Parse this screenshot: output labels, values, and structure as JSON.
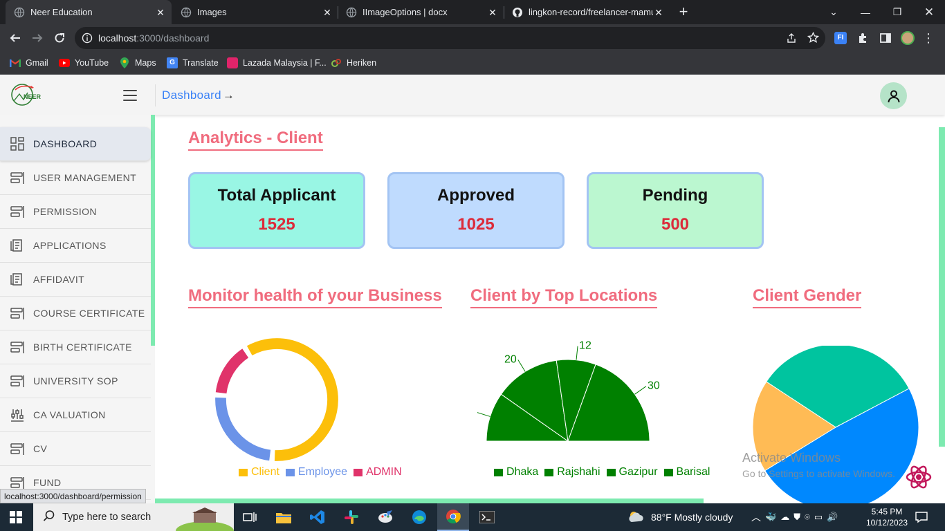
{
  "browser": {
    "tabs": [
      {
        "title": "Neer Education",
        "active": true
      },
      {
        "title": "Images",
        "active": false
      },
      {
        "title": "IImageOptions | docx",
        "active": false
      },
      {
        "title": "lingkon-record/freelancer-mamu",
        "active": false
      }
    ],
    "url_host": "localhost",
    "url_path": ":3000/dashboard",
    "bookmarks": [
      {
        "label": "Gmail",
        "icon": "gmail-icon"
      },
      {
        "label": "YouTube",
        "icon": "youtube-icon"
      },
      {
        "label": "Maps",
        "icon": "maps-icon"
      },
      {
        "label": "Translate",
        "icon": "translate-icon"
      },
      {
        "label": "Lazada Malaysia | F...",
        "icon": "lazada-icon"
      },
      {
        "label": "Heriken",
        "icon": "heriken-icon"
      }
    ],
    "status_url": "localhost:3000/dashboard/permission"
  },
  "header": {
    "logo_text": "NEER",
    "breadcrumb": "Dashboard",
    "breadcrumb_arrow": "→"
  },
  "sidebar": {
    "items": [
      {
        "label": "DASHBOARD",
        "icon": "dashboard-grid-icon",
        "active": true
      },
      {
        "label": "USER MANAGEMENT",
        "icon": "list-icon"
      },
      {
        "label": "PERMISSION",
        "icon": "list-icon"
      },
      {
        "label": "APPLICATIONS",
        "icon": "document-icon"
      },
      {
        "label": "AFFIDAVIT",
        "icon": "document-icon"
      },
      {
        "label": "COURSE CERTIFICATE",
        "icon": "list-icon"
      },
      {
        "label": "BIRTH CERTIFICATE",
        "icon": "list-icon"
      },
      {
        "label": "UNIVERSITY SOP",
        "icon": "list-icon"
      },
      {
        "label": "CA VALUATION",
        "icon": "sliders-icon"
      },
      {
        "label": "CV",
        "icon": "list-icon"
      },
      {
        "label": "FUND",
        "icon": "list-icon"
      }
    ]
  },
  "main": {
    "title": "Analytics - Client",
    "stats": [
      {
        "label": "Total Applicant",
        "value": "1525",
        "bg": "#99f6e4"
      },
      {
        "label": "Approved",
        "value": "1025",
        "bg": "#bfdbfe"
      },
      {
        "label": "Pending",
        "value": "500",
        "bg": "#bbf7d0"
      }
    ],
    "sections": {
      "health": "Monitor health of your Business",
      "locations": "Client by Top Locations",
      "gender": "Client Gender"
    }
  },
  "chart_data": [
    {
      "type": "pie",
      "variant": "donut",
      "categories": [
        "Client",
        "Employee",
        "ADMIN"
      ],
      "values": [
        60,
        25,
        15
      ],
      "colors": [
        "#fcbf0a",
        "#6b93e8",
        "#e0336a"
      ],
      "legend": "bottom"
    },
    {
      "type": "pie",
      "variant": "half-pie",
      "categories": [
        "Dhaka",
        "Rajshahi",
        "Gazipur",
        "Barisal"
      ],
      "values": [
        15,
        20,
        12,
        30
      ],
      "colors": [
        "#008000",
        "#008000",
        "#008000",
        "#008000"
      ],
      "legend": "bottom"
    },
    {
      "type": "pie",
      "categories": [
        "",
        "",
        ""
      ],
      "values": [
        33,
        49,
        18
      ],
      "colors": [
        "#00c49f",
        "#0088fe",
        "#ffbb55"
      ],
      "legend": "none"
    }
  ],
  "watermark": {
    "title": "Activate Windows",
    "subtitle": "Go to Settings to activate Windows."
  },
  "taskbar": {
    "search_placeholder": "Type here to search",
    "weather": "88°F  Mostly cloudy",
    "time": "5:45 PM",
    "date": "10/12/2023"
  }
}
